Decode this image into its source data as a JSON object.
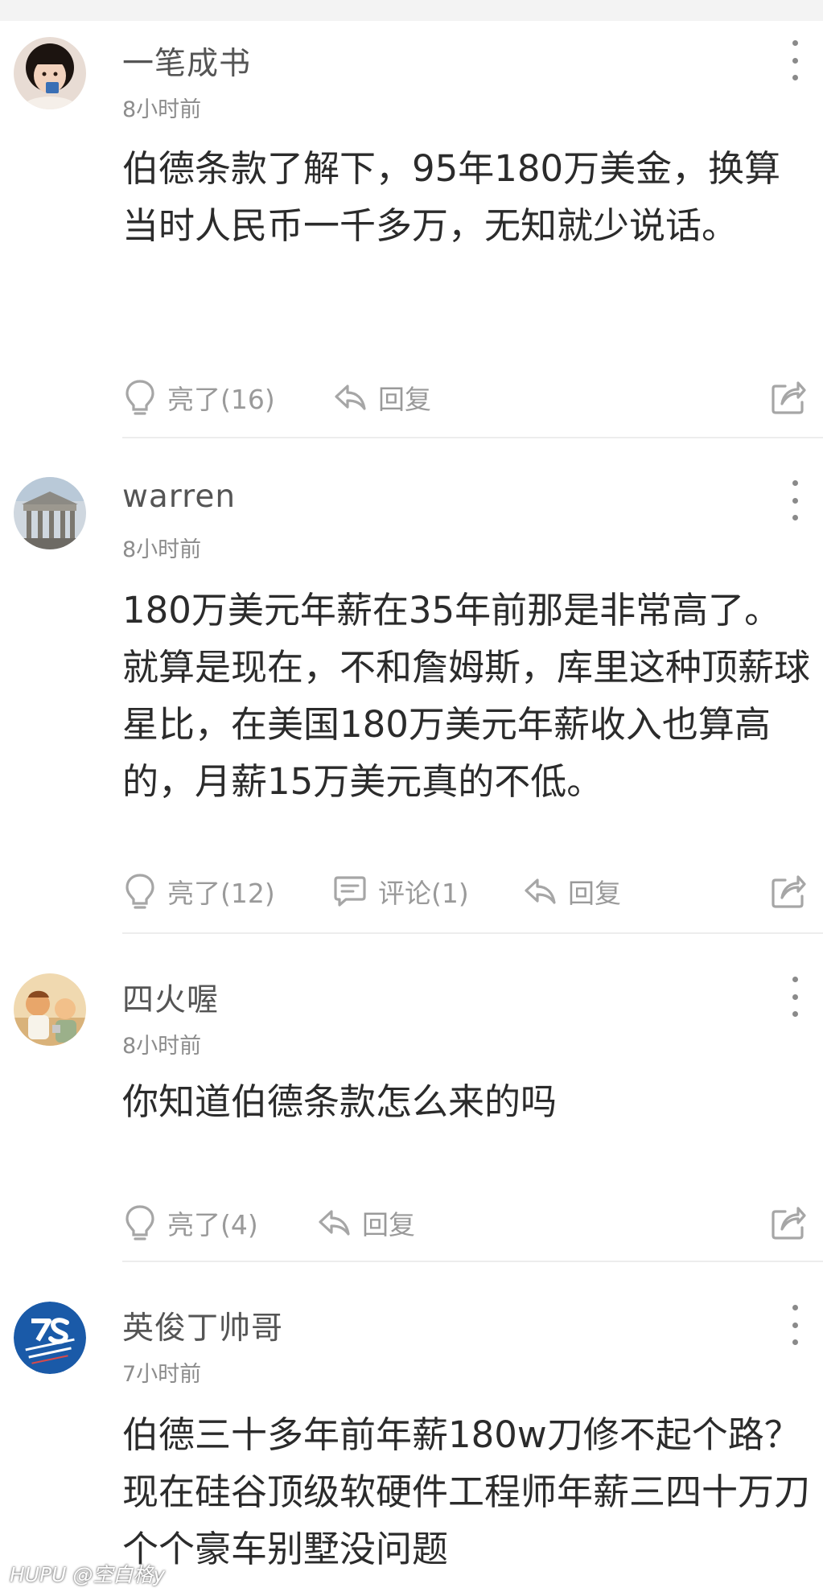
{
  "comments": [
    {
      "username": "一笔成书",
      "time": "8小时前",
      "text": "伯德条款了解下，95年180万美金，换算当时人民币一千多万，无知就少说话。",
      "light_label": "亮了(16)",
      "reply_label": "回复"
    },
    {
      "username": "warren",
      "time": "8小时前",
      "text": "180万美元年薪在35年前那是非常高了。就算是现在，不和詹姆斯，库里这种顶薪球星比，在美国180万美元年薪收入也算高的，月薪15万美元真的不低。",
      "light_label": "亮了(12)",
      "comment_label": "评论(1)",
      "reply_label": "回复"
    },
    {
      "username": "四火喔",
      "time": "8小时前",
      "text": "你知道伯德条款怎么来的吗",
      "light_label": "亮了(4)",
      "reply_label": "回复"
    },
    {
      "username": "英俊丁帅哥",
      "time": "7小时前",
      "text": "伯德三十多年前年薪180w刀修不起个路？现在硅谷顶级软硬件工程师年薪三四十万刀个个豪车别墅没问题"
    }
  ],
  "watermark": "HUPU @空白格y",
  "icons": {
    "light": "lightbulb-icon",
    "reply": "reply-arrow-icon",
    "comment": "comment-bubble-icon",
    "share": "share-icon",
    "more": "more-vertical-icon"
  },
  "colors": {
    "icon_gray": "#a6a6a6",
    "text_main": "#2b2b2b",
    "text_meta": "#8c8c8c",
    "avatar4_blue": "#1a5aa8"
  }
}
